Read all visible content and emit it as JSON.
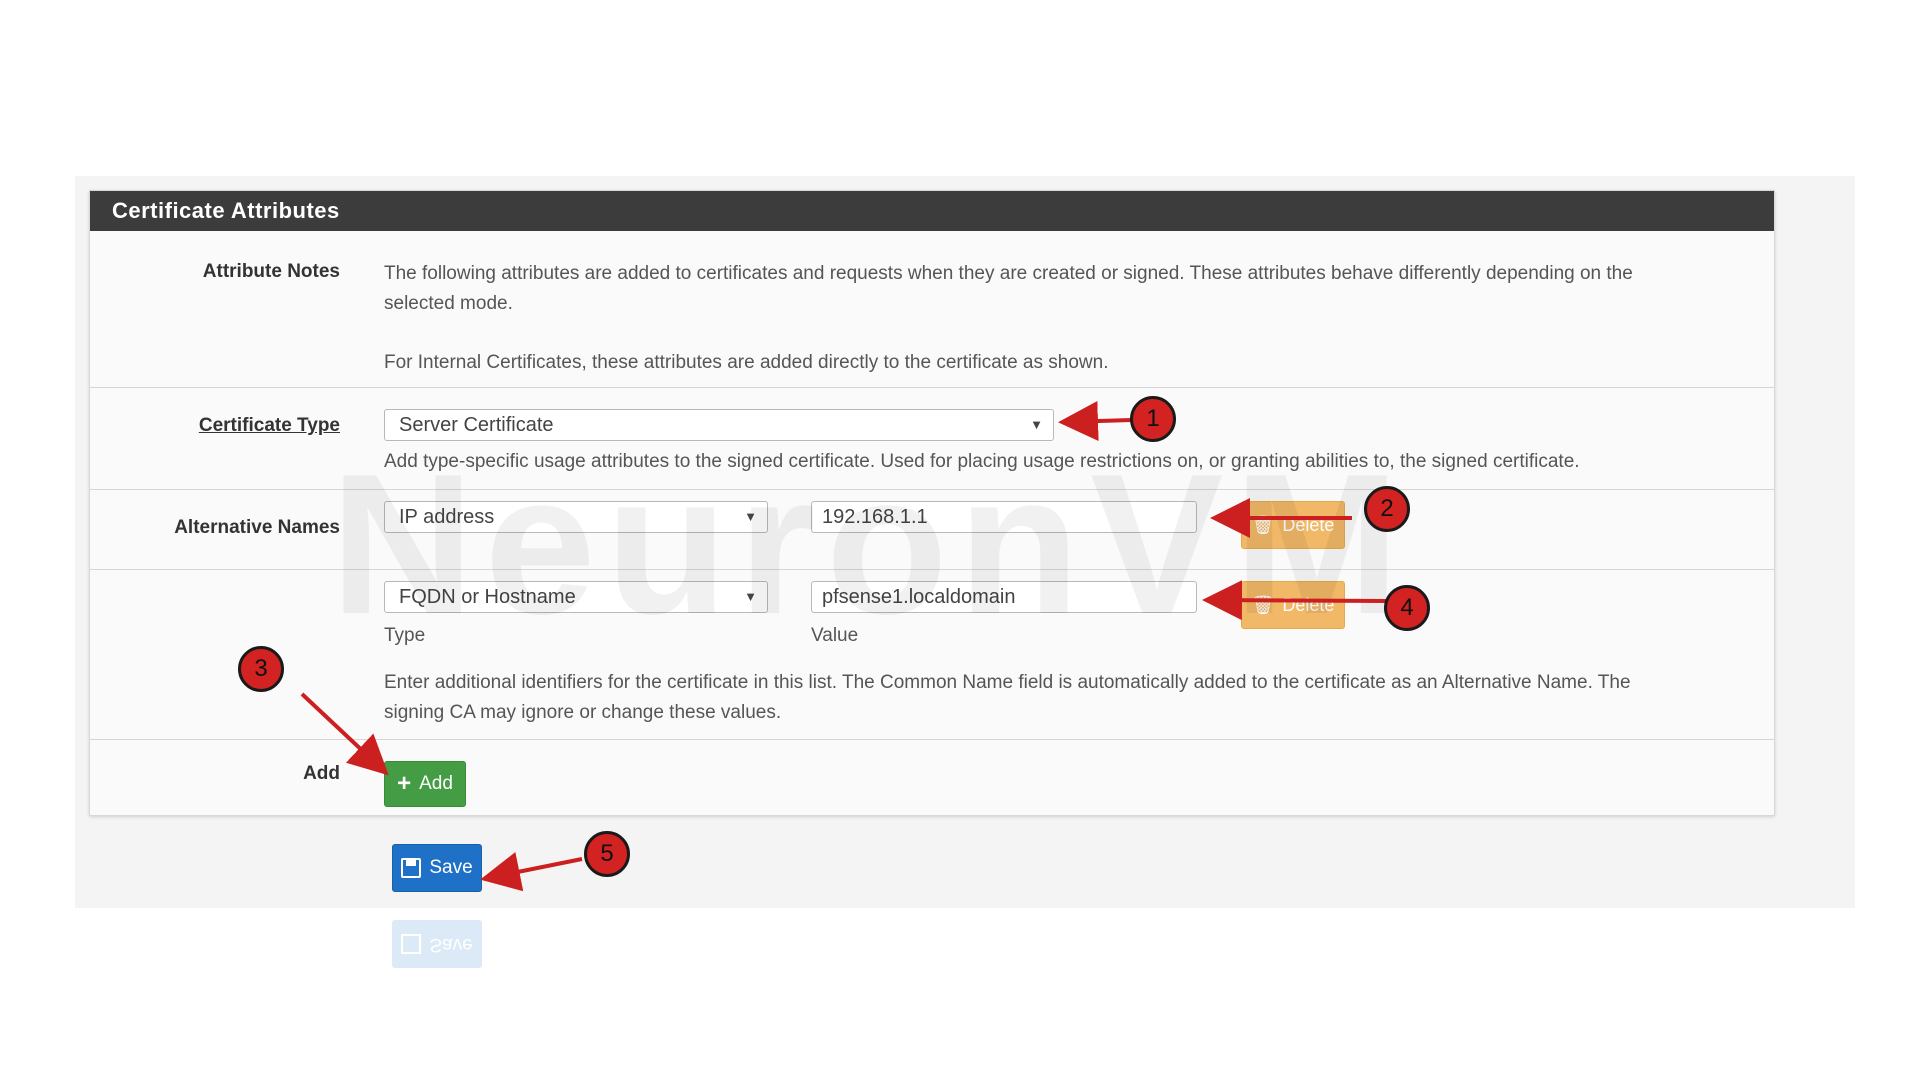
{
  "panel": {
    "title": "Certificate Attributes"
  },
  "attribute_notes": {
    "label": "Attribute Notes",
    "line1": "The following attributes are added to certificates and requests when they are created or signed. These attributes behave differently depending on the",
    "line2": "selected mode.",
    "line3": "For Internal Certificates, these attributes are added directly to the certificate as shown."
  },
  "certificate_type": {
    "label": "Certificate Type",
    "selected": "Server Certificate",
    "help": "Add type-specific usage attributes to the signed certificate. Used for placing usage restrictions on, or granting abilities to, the signed certificate."
  },
  "alternative_names": {
    "label": "Alternative Names",
    "rows": [
      {
        "type": "IP address",
        "value": "192.168.1.1",
        "delete_label": "Delete"
      },
      {
        "type": "FQDN or Hostname",
        "value": "pfsense1.localdomain",
        "delete_label": "Delete"
      }
    ],
    "type_caption": "Type",
    "value_caption": "Value",
    "help_line1": "Enter additional identifiers for the certificate in this list. The Common Name field is automatically added to the certificate as an Alternative Name. The",
    "help_line2": "signing CA may ignore or change these values."
  },
  "add_row": {
    "label": "Add",
    "button_label": "Add"
  },
  "save_button": {
    "label": "Save"
  },
  "watermark": {
    "text": "NeuronVM"
  },
  "callouts": [
    "1",
    "2",
    "3",
    "4",
    "5"
  ],
  "colors": {
    "heading_bg": "#3c3c3c",
    "add_green": "#449d44",
    "save_blue": "#1e71c7",
    "delete_orange": "#f0ad4e",
    "callout_red": "#d32222",
    "arrow_red": "#cc1f1f"
  },
  "icons": {
    "add": "plus-icon",
    "save": "floppy-disk-icon",
    "delete": "trash-icon",
    "caret": "caret-down-icon"
  }
}
